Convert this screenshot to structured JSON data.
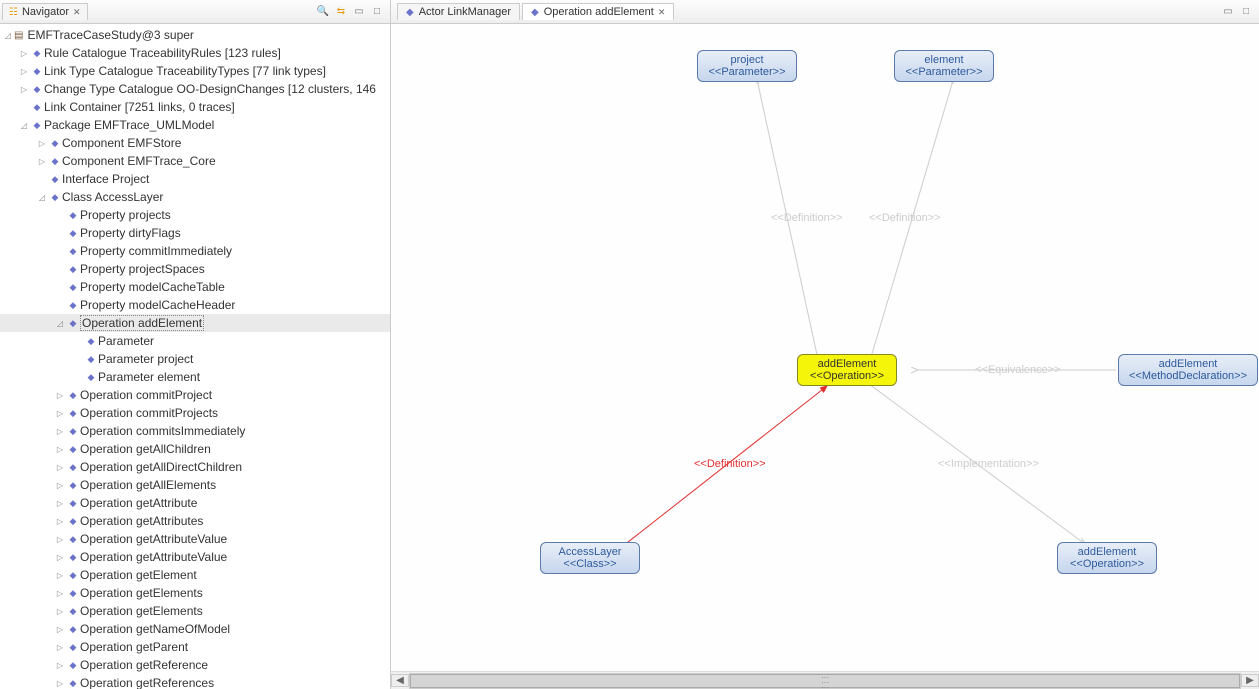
{
  "left": {
    "tab": "Navigator",
    "root": "EMFTraceCaseStudy@3 super",
    "items": [
      {
        "label": "Rule Catalogue TraceabilityRules [123 rules]",
        "indent": 1,
        "twisty": "▷",
        "icon": "◆"
      },
      {
        "label": "Link Type Catalogue TraceabilityTypes [77 link types]",
        "indent": 1,
        "twisty": "▷",
        "icon": "◆"
      },
      {
        "label": "Change Type Catalogue OO-DesignChanges [12 clusters, 146",
        "indent": 1,
        "twisty": "▷",
        "icon": "◆"
      },
      {
        "label": "Link Container [7251 links, 0 traces]",
        "indent": 1,
        "twisty": "",
        "icon": "◆"
      },
      {
        "label": "Package EMFTrace_UMLModel",
        "indent": 1,
        "twisty": "◿",
        "icon": "◆"
      },
      {
        "label": "Component EMFStore",
        "indent": 2,
        "twisty": "▷",
        "icon": "◆"
      },
      {
        "label": "Component EMFTrace_Core",
        "indent": 2,
        "twisty": "▷",
        "icon": "◆"
      },
      {
        "label": "Interface Project",
        "indent": 2,
        "twisty": "",
        "icon": "◆"
      },
      {
        "label": "Class AccessLayer",
        "indent": 2,
        "twisty": "◿",
        "icon": "◆"
      },
      {
        "label": "Property projects",
        "indent": 3,
        "twisty": "",
        "icon": "◆"
      },
      {
        "label": "Property dirtyFlags",
        "indent": 3,
        "twisty": "",
        "icon": "◆"
      },
      {
        "label": "Property commitImmediately",
        "indent": 3,
        "twisty": "",
        "icon": "◆"
      },
      {
        "label": "Property projectSpaces",
        "indent": 3,
        "twisty": "",
        "icon": "◆"
      },
      {
        "label": "Property modelCacheTable",
        "indent": 3,
        "twisty": "",
        "icon": "◆"
      },
      {
        "label": "Property modelCacheHeader",
        "indent": 3,
        "twisty": "",
        "icon": "◆"
      },
      {
        "label": "Operation addElement",
        "indent": 3,
        "twisty": "◿",
        "icon": "◆",
        "selected": true
      },
      {
        "label": "Parameter",
        "indent": 4,
        "twisty": "",
        "icon": "◆"
      },
      {
        "label": "Parameter project",
        "indent": 4,
        "twisty": "",
        "icon": "◆"
      },
      {
        "label": "Parameter element",
        "indent": 4,
        "twisty": "",
        "icon": "◆"
      },
      {
        "label": "Operation commitProject",
        "indent": 3,
        "twisty": "▷",
        "icon": "◆"
      },
      {
        "label": "Operation commitProjects",
        "indent": 3,
        "twisty": "▷",
        "icon": "◆"
      },
      {
        "label": "Operation commitsImmediately",
        "indent": 3,
        "twisty": "▷",
        "icon": "◆"
      },
      {
        "label": "Operation getAllChildren",
        "indent": 3,
        "twisty": "▷",
        "icon": "◆"
      },
      {
        "label": "Operation getAllDirectChildren",
        "indent": 3,
        "twisty": "▷",
        "icon": "◆"
      },
      {
        "label": "Operation getAllElements",
        "indent": 3,
        "twisty": "▷",
        "icon": "◆"
      },
      {
        "label": "Operation getAttribute",
        "indent": 3,
        "twisty": "▷",
        "icon": "◆"
      },
      {
        "label": "Operation getAttributes",
        "indent": 3,
        "twisty": "▷",
        "icon": "◆"
      },
      {
        "label": "Operation getAttributeValue",
        "indent": 3,
        "twisty": "▷",
        "icon": "◆"
      },
      {
        "label": "Operation getAttributeValue",
        "indent": 3,
        "twisty": "▷",
        "icon": "◆"
      },
      {
        "label": "Operation getElement",
        "indent": 3,
        "twisty": "▷",
        "icon": "◆"
      },
      {
        "label": "Operation getElements",
        "indent": 3,
        "twisty": "▷",
        "icon": "◆"
      },
      {
        "label": "Operation getElements",
        "indent": 3,
        "twisty": "▷",
        "icon": "◆"
      },
      {
        "label": "Operation getNameOfModel",
        "indent": 3,
        "twisty": "▷",
        "icon": "◆"
      },
      {
        "label": "Operation getParent",
        "indent": 3,
        "twisty": "▷",
        "icon": "◆"
      },
      {
        "label": "Operation getReference",
        "indent": 3,
        "twisty": "▷",
        "icon": "◆"
      },
      {
        "label": "Operation getReferences",
        "indent": 3,
        "twisty": "▷",
        "icon": "◆"
      }
    ]
  },
  "right": {
    "tabs": [
      {
        "label": "Actor LinkManager",
        "active": false
      },
      {
        "label": "Operation addElement",
        "active": true
      }
    ],
    "nodes": {
      "project": {
        "title": "project",
        "sub": "<<Parameter>>"
      },
      "element": {
        "title": "element",
        "sub": "<<Parameter>>"
      },
      "add_center": {
        "title": "addElement",
        "sub": "<<Operation>>"
      },
      "add_method": {
        "title": "addElement",
        "sub": "<<MethodDeclaration>>"
      },
      "access": {
        "title": "AccessLayer",
        "sub": "<<Class>>"
      },
      "add_op_br": {
        "title": "addElement",
        "sub": "<<Operation>>"
      }
    },
    "edgeLabels": {
      "def1": "<<Definition>>",
      "def2": "<<Definition>>",
      "equiv": "<<Equivalence>>",
      "impl": "<<Implementation>>",
      "def3": "<<Definition>>"
    }
  }
}
